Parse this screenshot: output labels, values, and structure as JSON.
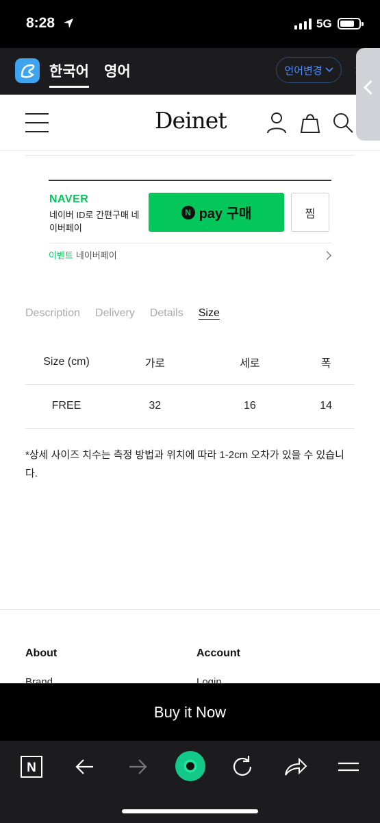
{
  "status_bar": {
    "time": "8:28",
    "network": "5G"
  },
  "translation_bar": {
    "active_lang": "한국어",
    "other_lang": "영어",
    "change_label": "언어변경",
    "close": "×"
  },
  "site": {
    "logo": "Deinet",
    "naver": {
      "brand": "NAVER",
      "description": "네이버 ID로 간편구매 네이버페이",
      "pay_n": "N",
      "pay_label": "pay 구매",
      "zzim_label": "찜",
      "event_label": "이벤트",
      "event_text": "네이버페이"
    },
    "tabs": [
      "Description",
      "Delivery",
      "Details",
      "Size"
    ],
    "active_tab": "Size",
    "size_table": {
      "headers": [
        "Size (cm)",
        "가로",
        "세로",
        "폭"
      ],
      "rows": [
        [
          "FREE",
          "32",
          "16",
          "14"
        ]
      ]
    },
    "note": "*상세 사이즈 치수는 측정 방법과 위치에 따라 1-2cm 오차가 있을 수 있습니다.",
    "footer": {
      "col1_title": "About",
      "col1_item": "Brand",
      "col2_title": "Account",
      "col2_item": "Login"
    }
  },
  "buy_now_label": "Buy it Now",
  "browser_bar": {
    "naver_n": "N",
    "icons": [
      "naver-home-icon",
      "back-arrow-icon",
      "forward-arrow-icon",
      "green-dot-icon",
      "refresh-icon",
      "share-icon",
      "menu-icon"
    ]
  }
}
